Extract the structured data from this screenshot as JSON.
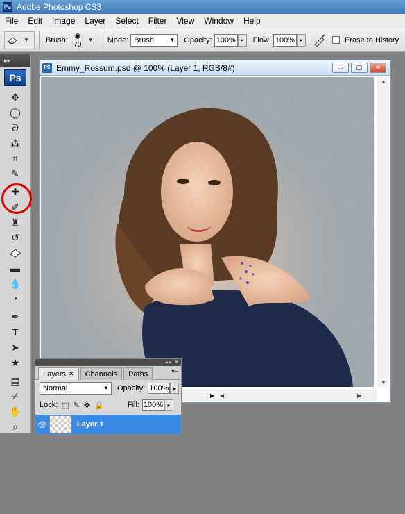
{
  "app": {
    "title": "Adobe Photoshop CS3",
    "logo_text": "Ps"
  },
  "menu": [
    "File",
    "Edit",
    "Image",
    "Layer",
    "Select",
    "Filter",
    "View",
    "Window",
    "Help"
  ],
  "options": {
    "brush_label": "Brush:",
    "brush_size": "70",
    "mode_label": "Mode:",
    "mode_value": "Brush",
    "opacity_label": "Opacity:",
    "opacity_value": "100%",
    "flow_label": "Flow:",
    "flow_value": "100%",
    "erase_history_label": "Erase to History"
  },
  "document": {
    "title": "Emmy_Rossum.psd @ 100% (Layer 1, RGB/8#)",
    "icon_text": "PS"
  },
  "layers_panel": {
    "tabs": [
      "Layers",
      "Channels",
      "Paths"
    ],
    "blend_mode": "Normal",
    "opacity_label": "Opacity:",
    "opacity_value": "100%",
    "lock_label": "Lock:",
    "fill_label": "Fill:",
    "fill_value": "100%",
    "layer_name": "Layer 1"
  },
  "icons": {
    "eraser": "eraser-icon",
    "highlight_color": "#e00000",
    "selected_layer_color": "#3a89e6"
  }
}
